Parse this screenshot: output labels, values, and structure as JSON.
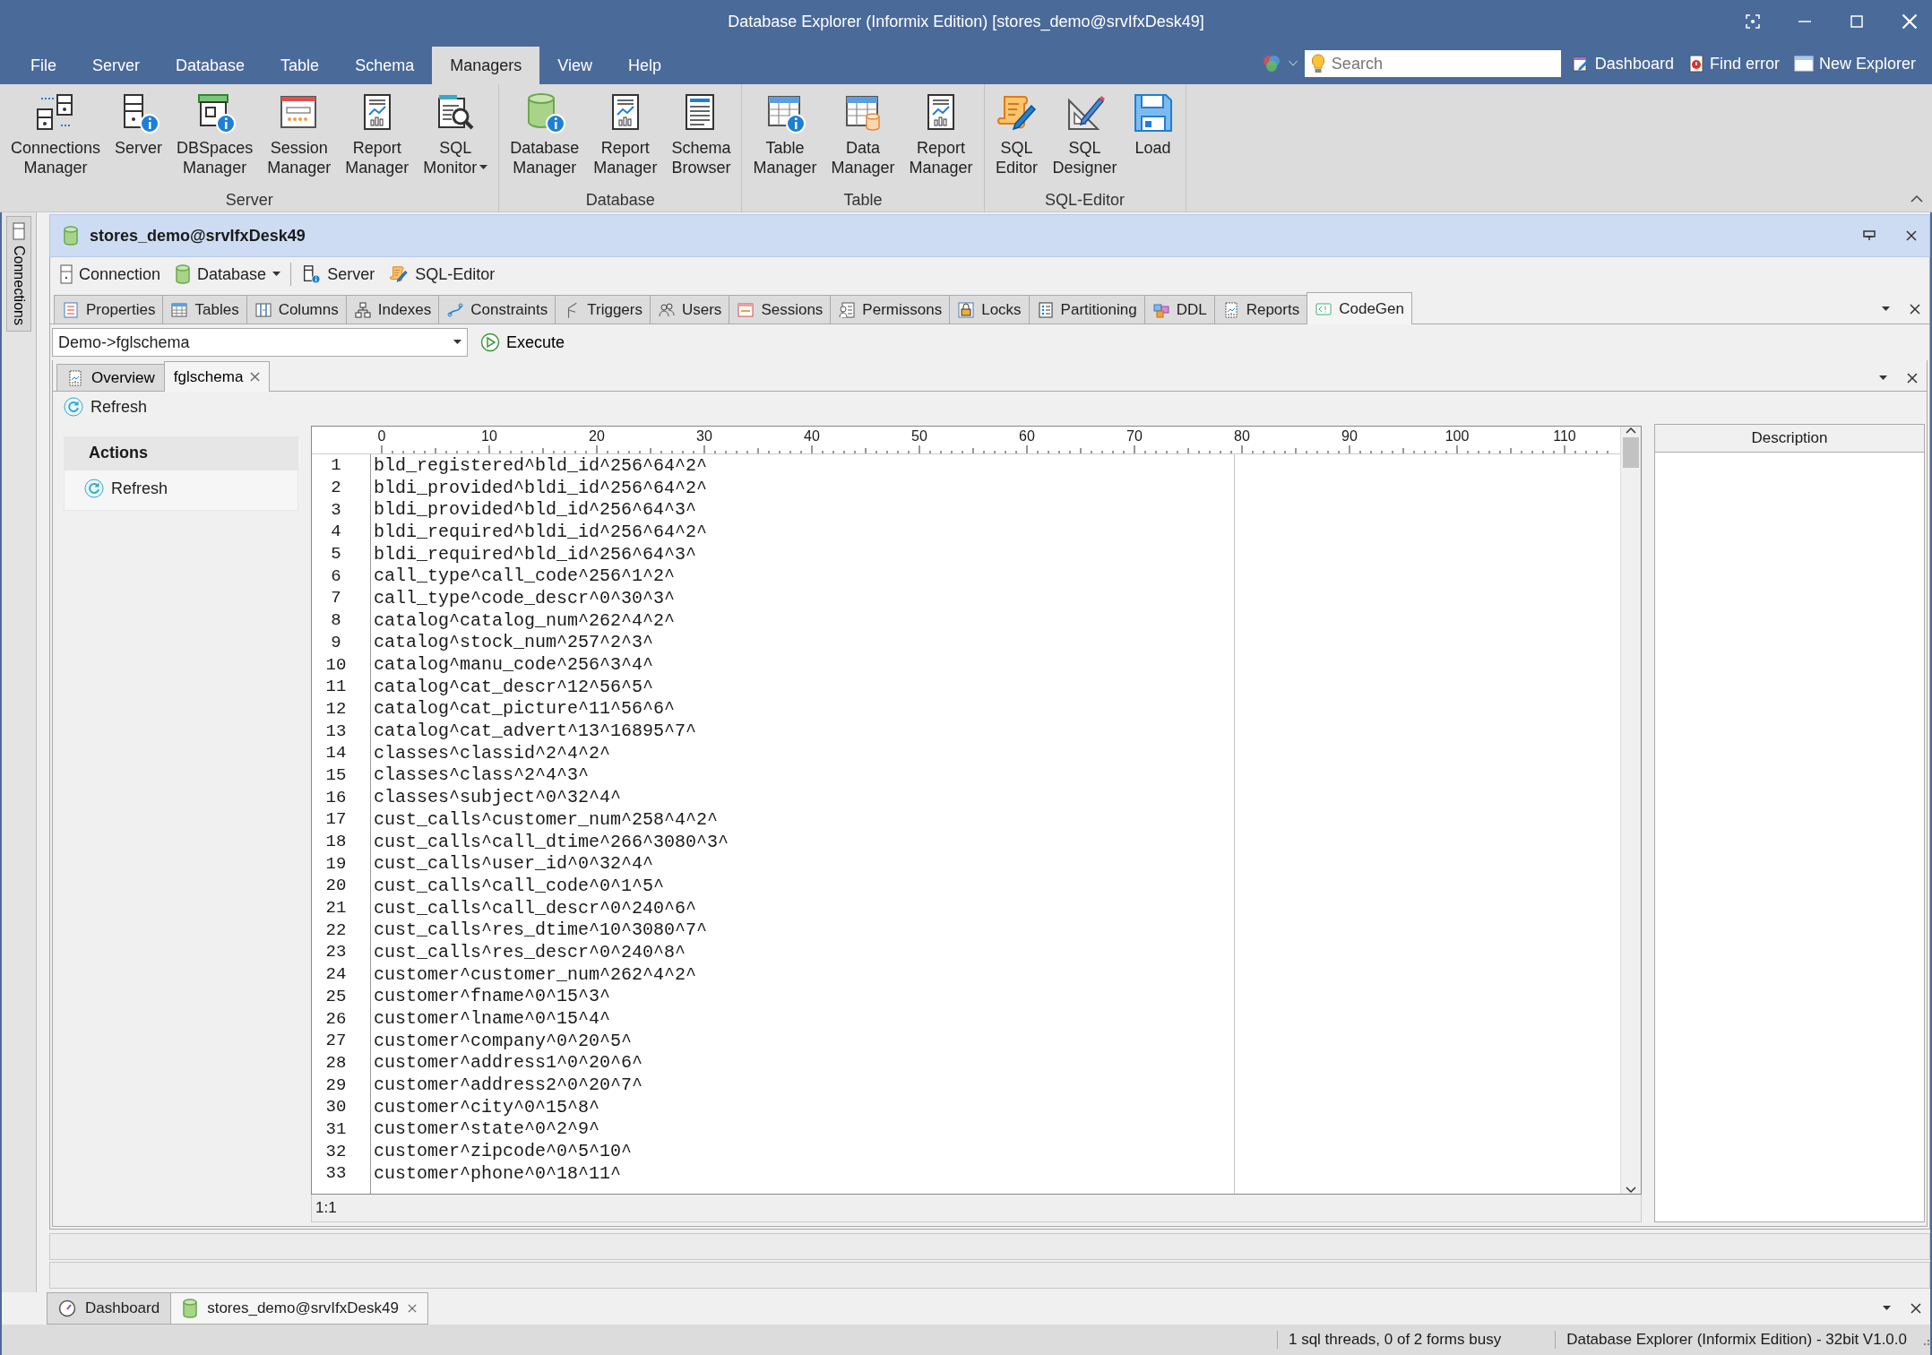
{
  "window": {
    "title": "Database Explorer (Informix Edition) [stores_demo@srvIfxDesk49]"
  },
  "menu": [
    {
      "label": "File",
      "selected": false
    },
    {
      "label": "Server",
      "selected": false
    },
    {
      "label": "Database",
      "selected": false
    },
    {
      "label": "Table",
      "selected": false
    },
    {
      "label": "Schema",
      "selected": false
    },
    {
      "label": "Managers",
      "selected": true
    },
    {
      "label": "View",
      "selected": false
    },
    {
      "label": "Help",
      "selected": false
    }
  ],
  "quick_search": {
    "placeholder": "Search"
  },
  "quick_links": [
    "Dashboard",
    "Find error",
    "New Explorer"
  ],
  "ribbon": {
    "groups": [
      {
        "label": "Server",
        "items": [
          {
            "lines": [
              "Connections",
              "Manager"
            ],
            "dropdown": false
          },
          {
            "lines": [
              "Server"
            ],
            "dropdown": false
          },
          {
            "lines": [
              "DBSpaces",
              "Manager"
            ],
            "dropdown": false
          },
          {
            "lines": [
              "Session",
              "Manager"
            ],
            "dropdown": false
          },
          {
            "lines": [
              "Report",
              "Manager"
            ],
            "dropdown": false
          },
          {
            "lines": [
              "SQL",
              "Monitor"
            ],
            "dropdown": true
          }
        ]
      },
      {
        "label": "Database",
        "items": [
          {
            "lines": [
              "Database",
              "Manager"
            ],
            "dropdown": false
          },
          {
            "lines": [
              "Report",
              "Manager"
            ],
            "dropdown": false
          },
          {
            "lines": [
              "Schema",
              "Browser"
            ],
            "dropdown": false
          }
        ]
      },
      {
        "label": "Table",
        "items": [
          {
            "lines": [
              "Table",
              "Manager"
            ],
            "dropdown": false
          },
          {
            "lines": [
              "Data",
              "Manager"
            ],
            "dropdown": false
          },
          {
            "lines": [
              "Report",
              "Manager"
            ],
            "dropdown": false
          }
        ]
      },
      {
        "label": "SQL-Editor",
        "items": [
          {
            "lines": [
              "SQL",
              "Editor"
            ],
            "dropdown": false
          },
          {
            "lines": [
              "SQL",
              "Designer"
            ],
            "dropdown": false
          },
          {
            "lines": [
              "Load"
            ],
            "dropdown": false
          }
        ]
      }
    ]
  },
  "side_tab": "Connections",
  "document": {
    "title": "stores_demo@srvIfxDesk49",
    "toolbar": [
      {
        "label": "Connection",
        "dropdown": false
      },
      {
        "label": "Database",
        "dropdown": true
      },
      {
        "label": "Server",
        "dropdown": false
      },
      {
        "label": "SQL-Editor",
        "dropdown": false
      }
    ],
    "tabs": [
      {
        "label": "Properties",
        "selected": false
      },
      {
        "label": "Tables",
        "selected": false
      },
      {
        "label": "Columns",
        "selected": false
      },
      {
        "label": "Indexes",
        "selected": false
      },
      {
        "label": "Constraints",
        "selected": false
      },
      {
        "label": "Triggers",
        "selected": false
      },
      {
        "label": "Users",
        "selected": false
      },
      {
        "label": "Sessions",
        "selected": false
      },
      {
        "label": "Permissons",
        "selected": false
      },
      {
        "label": "Locks",
        "selected": false
      },
      {
        "label": "Partitioning",
        "selected": false
      },
      {
        "label": "DDL",
        "selected": false
      },
      {
        "label": "Reports",
        "selected": false
      },
      {
        "label": "CodeGen",
        "selected": true
      }
    ],
    "schema_select": {
      "value": "Demo->fglschema"
    },
    "execute": "Execute",
    "subtabs": [
      {
        "label": "Overview",
        "selected": false,
        "closable": false
      },
      {
        "label": "fglschema",
        "selected": true,
        "closable": true
      }
    ],
    "refresh": "Refresh",
    "actions": {
      "title": "Actions",
      "items": [
        "Refresh"
      ]
    },
    "editor": {
      "ruler": [
        "0",
        "10",
        "20",
        "30",
        "40",
        "50",
        "60",
        "70",
        "80",
        "90",
        "100",
        "110"
      ],
      "lines": [
        {
          "number": "1",
          "text": "bld_registered^bld_id^256^64^2^"
        },
        {
          "number": "2",
          "text": "bldi_provided^bldi_id^256^64^2^"
        },
        {
          "number": "3",
          "text": "bldi_provided^bld_id^256^64^3^"
        },
        {
          "number": "4",
          "text": "bldi_required^bldi_id^256^64^2^"
        },
        {
          "number": "5",
          "text": "bldi_required^bld_id^256^64^3^"
        },
        {
          "number": "6",
          "text": "call_type^call_code^256^1^2^"
        },
        {
          "number": "7",
          "text": "call_type^code_descr^0^30^3^"
        },
        {
          "number": "8",
          "text": "catalog^catalog_num^262^4^2^"
        },
        {
          "number": "9",
          "text": "catalog^stock_num^257^2^3^"
        },
        {
          "number": "10",
          "text": "catalog^manu_code^256^3^4^"
        },
        {
          "number": "11",
          "text": "catalog^cat_descr^12^56^5^"
        },
        {
          "number": "12",
          "text": "catalog^cat_picture^11^56^6^"
        },
        {
          "number": "13",
          "text": "catalog^cat_advert^13^16895^7^"
        },
        {
          "number": "14",
          "text": "classes^classid^2^4^2^"
        },
        {
          "number": "15",
          "text": "classes^class^2^4^3^"
        },
        {
          "number": "16",
          "text": "classes^subject^0^32^4^"
        },
        {
          "number": "17",
          "text": "cust_calls^customer_num^258^4^2^"
        },
        {
          "number": "18",
          "text": "cust_calls^call_dtime^266^3080^3^"
        },
        {
          "number": "19",
          "text": "cust_calls^user_id^0^32^4^"
        },
        {
          "number": "20",
          "text": "cust_calls^call_code^0^1^5^"
        },
        {
          "number": "21",
          "text": "cust_calls^call_descr^0^240^6^"
        },
        {
          "number": "22",
          "text": "cust_calls^res_dtime^10^3080^7^"
        },
        {
          "number": "23",
          "text": "cust_calls^res_descr^0^240^8^"
        },
        {
          "number": "24",
          "text": "customer^customer_num^262^4^2^"
        },
        {
          "number": "25",
          "text": "customer^fname^0^15^3^"
        },
        {
          "number": "26",
          "text": "customer^lname^0^15^4^"
        },
        {
          "number": "27",
          "text": "customer^company^0^20^5^"
        },
        {
          "number": "28",
          "text": "customer^address1^0^20^6^"
        },
        {
          "number": "29",
          "text": "customer^address2^0^20^7^"
        },
        {
          "number": "30",
          "text": "customer^city^0^15^8^"
        },
        {
          "number": "31",
          "text": "customer^state^0^2^9^"
        },
        {
          "number": "32",
          "text": "customer^zipcode^0^5^10^"
        },
        {
          "number": "33",
          "text": "customer^phone^0^18^11^"
        }
      ],
      "cursor": "1:1"
    },
    "description_header": "Description"
  },
  "bottom_tabs": [
    {
      "label": "Dashboard",
      "selected": false,
      "closable": false
    },
    {
      "label": "stores_demo@srvIfxDesk49",
      "selected": true,
      "closable": true
    }
  ],
  "status_bar": [
    "1 sql threads, 0 of 2 forms busy",
    "Database Explorer (Informix Edition) - 32bit V1.0.0"
  ]
}
